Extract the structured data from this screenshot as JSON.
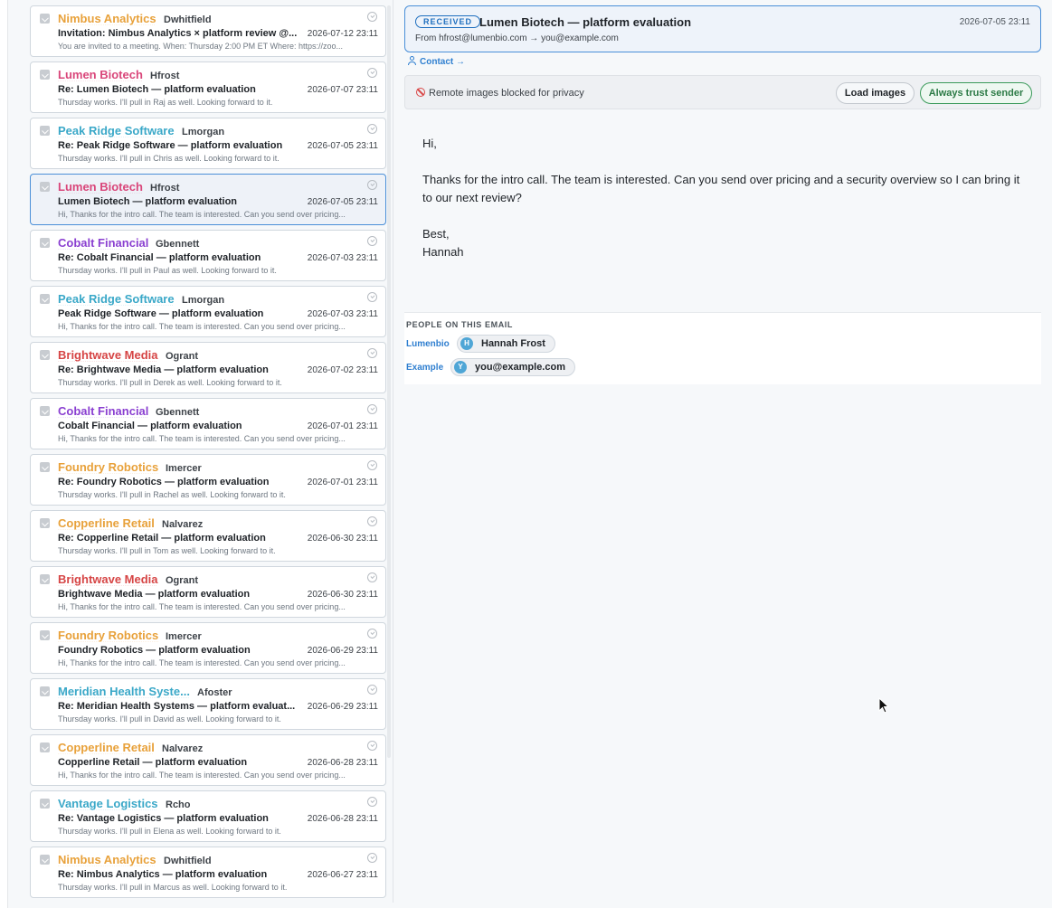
{
  "inbox": {
    "items": [
      {
        "company": "Nimbus Analytics",
        "color": "#e8a13a",
        "sender": "Dwhitfield",
        "subject": "Invitation: Nimbus Analytics × platform review @...",
        "date": "2026-07-12 23:11",
        "snippet": "You are invited to a meeting. When: Thursday 2:00 PM ET Where: https://zoo..."
      },
      {
        "company": "Lumen Biotech",
        "color": "#d9467a",
        "sender": "Hfrost",
        "subject": "Re: Lumen Biotech — platform evaluation",
        "date": "2026-07-07 23:11",
        "snippet": "Thursday works. I'll pull in Raj as well. Looking forward to it."
      },
      {
        "company": "Peak Ridge Software",
        "color": "#3aa8c8",
        "sender": "Lmorgan",
        "subject": "Re: Peak Ridge Software — platform evaluation",
        "date": "2026-07-05 23:11",
        "snippet": "Thursday works. I'll pull in Chris as well. Looking forward to it."
      },
      {
        "company": "Lumen Biotech",
        "color": "#d9467a",
        "sender": "Hfrost",
        "subject": "Lumen Biotech — platform evaluation",
        "date": "2026-07-05 23:11",
        "snippet": "Hi, Thanks for the intro call. The team is interested. Can you send over pricing...",
        "selected": true
      },
      {
        "company": "Cobalt Financial",
        "color": "#8a3fd1",
        "sender": "Gbennett",
        "subject": "Re: Cobalt Financial — platform evaluation",
        "date": "2026-07-03 23:11",
        "snippet": "Thursday works. I'll pull in Paul as well. Looking forward to it."
      },
      {
        "company": "Peak Ridge Software",
        "color": "#3aa8c8",
        "sender": "Lmorgan",
        "subject": "Peak Ridge Software — platform evaluation",
        "date": "2026-07-03 23:11",
        "snippet": "Hi, Thanks for the intro call. The team is interested. Can you send over pricing..."
      },
      {
        "company": "Brightwave Media",
        "color": "#d64545",
        "sender": "Ogrant",
        "subject": "Re: Brightwave Media — platform evaluation",
        "date": "2026-07-02 23:11",
        "snippet": "Thursday works. I'll pull in Derek as well. Looking forward to it."
      },
      {
        "company": "Cobalt Financial",
        "color": "#8a3fd1",
        "sender": "Gbennett",
        "subject": "Cobalt Financial — platform evaluation",
        "date": "2026-07-01 23:11",
        "snippet": "Hi, Thanks for the intro call. The team is interested. Can you send over pricing..."
      },
      {
        "company": "Foundry Robotics",
        "color": "#e8a13a",
        "sender": "Imercer",
        "subject": "Re: Foundry Robotics — platform evaluation",
        "date": "2026-07-01 23:11",
        "snippet": "Thursday works. I'll pull in Rachel as well. Looking forward to it."
      },
      {
        "company": "Copperline Retail",
        "color": "#e8a13a",
        "sender": "Nalvarez",
        "subject": "Re: Copperline Retail — platform evaluation",
        "date": "2026-06-30 23:11",
        "snippet": "Thursday works. I'll pull in Tom as well. Looking forward to it."
      },
      {
        "company": "Brightwave Media",
        "color": "#d64545",
        "sender": "Ogrant",
        "subject": "Brightwave Media — platform evaluation",
        "date": "2026-06-30 23:11",
        "snippet": "Hi, Thanks for the intro call. The team is interested. Can you send over pricing..."
      },
      {
        "company": "Foundry Robotics",
        "color": "#e8a13a",
        "sender": "Imercer",
        "subject": "Foundry Robotics — platform evaluation",
        "date": "2026-06-29 23:11",
        "snippet": "Hi, Thanks for the intro call. The team is interested. Can you send over pricing..."
      },
      {
        "company": "Meridian Health Syste...",
        "color": "#3aa8c8",
        "sender": "Afoster",
        "subject": "Re: Meridian Health Systems — platform evaluat...",
        "date": "2026-06-29 23:11",
        "snippet": "Thursday works. I'll pull in David as well. Looking forward to it."
      },
      {
        "company": "Copperline Retail",
        "color": "#e8a13a",
        "sender": "Nalvarez",
        "subject": "Copperline Retail — platform evaluation",
        "date": "2026-06-28 23:11",
        "snippet": "Hi, Thanks for the intro call. The team is interested. Can you send over pricing..."
      },
      {
        "company": "Vantage Logistics",
        "color": "#3aa8c8",
        "sender": "Rcho",
        "subject": "Re: Vantage Logistics — platform evaluation",
        "date": "2026-06-28 23:11",
        "snippet": "Thursday works. I'll pull in Elena as well. Looking forward to it."
      },
      {
        "company": "Nimbus Analytics",
        "color": "#e8a13a",
        "sender": "Dwhitfield",
        "subject": "Re: Nimbus Analytics — platform evaluation",
        "date": "2026-06-27 23:11",
        "snippet": "Thursday works. I'll pull in Marcus as well. Looking forward to it."
      }
    ]
  },
  "reader": {
    "badge": "RECEIVED",
    "title": "Lumen Biotech — platform evaluation",
    "date": "2026-07-05 23:11",
    "from_line": "From hfrost@lumenbio.com → you@example.com",
    "contact_label": "Contact →",
    "images_blocked": "Remote images blocked for privacy",
    "load_images": "Load images",
    "always_trust": "Always trust sender",
    "body": {
      "greeting": "Hi,",
      "paragraph": "Thanks for the intro call. The team is interested. Can you send over pricing and a security overview so I can bring it to our next review?",
      "signoff": "Best,",
      "name": "Hannah"
    },
    "people": {
      "title": "PEOPLE ON THIS EMAIL",
      "groups": [
        {
          "org": "Lumenbio",
          "initial": "H",
          "name": "Hannah Frost"
        },
        {
          "org": "Example",
          "initial": "Y",
          "name": "you@example.com"
        }
      ]
    }
  }
}
